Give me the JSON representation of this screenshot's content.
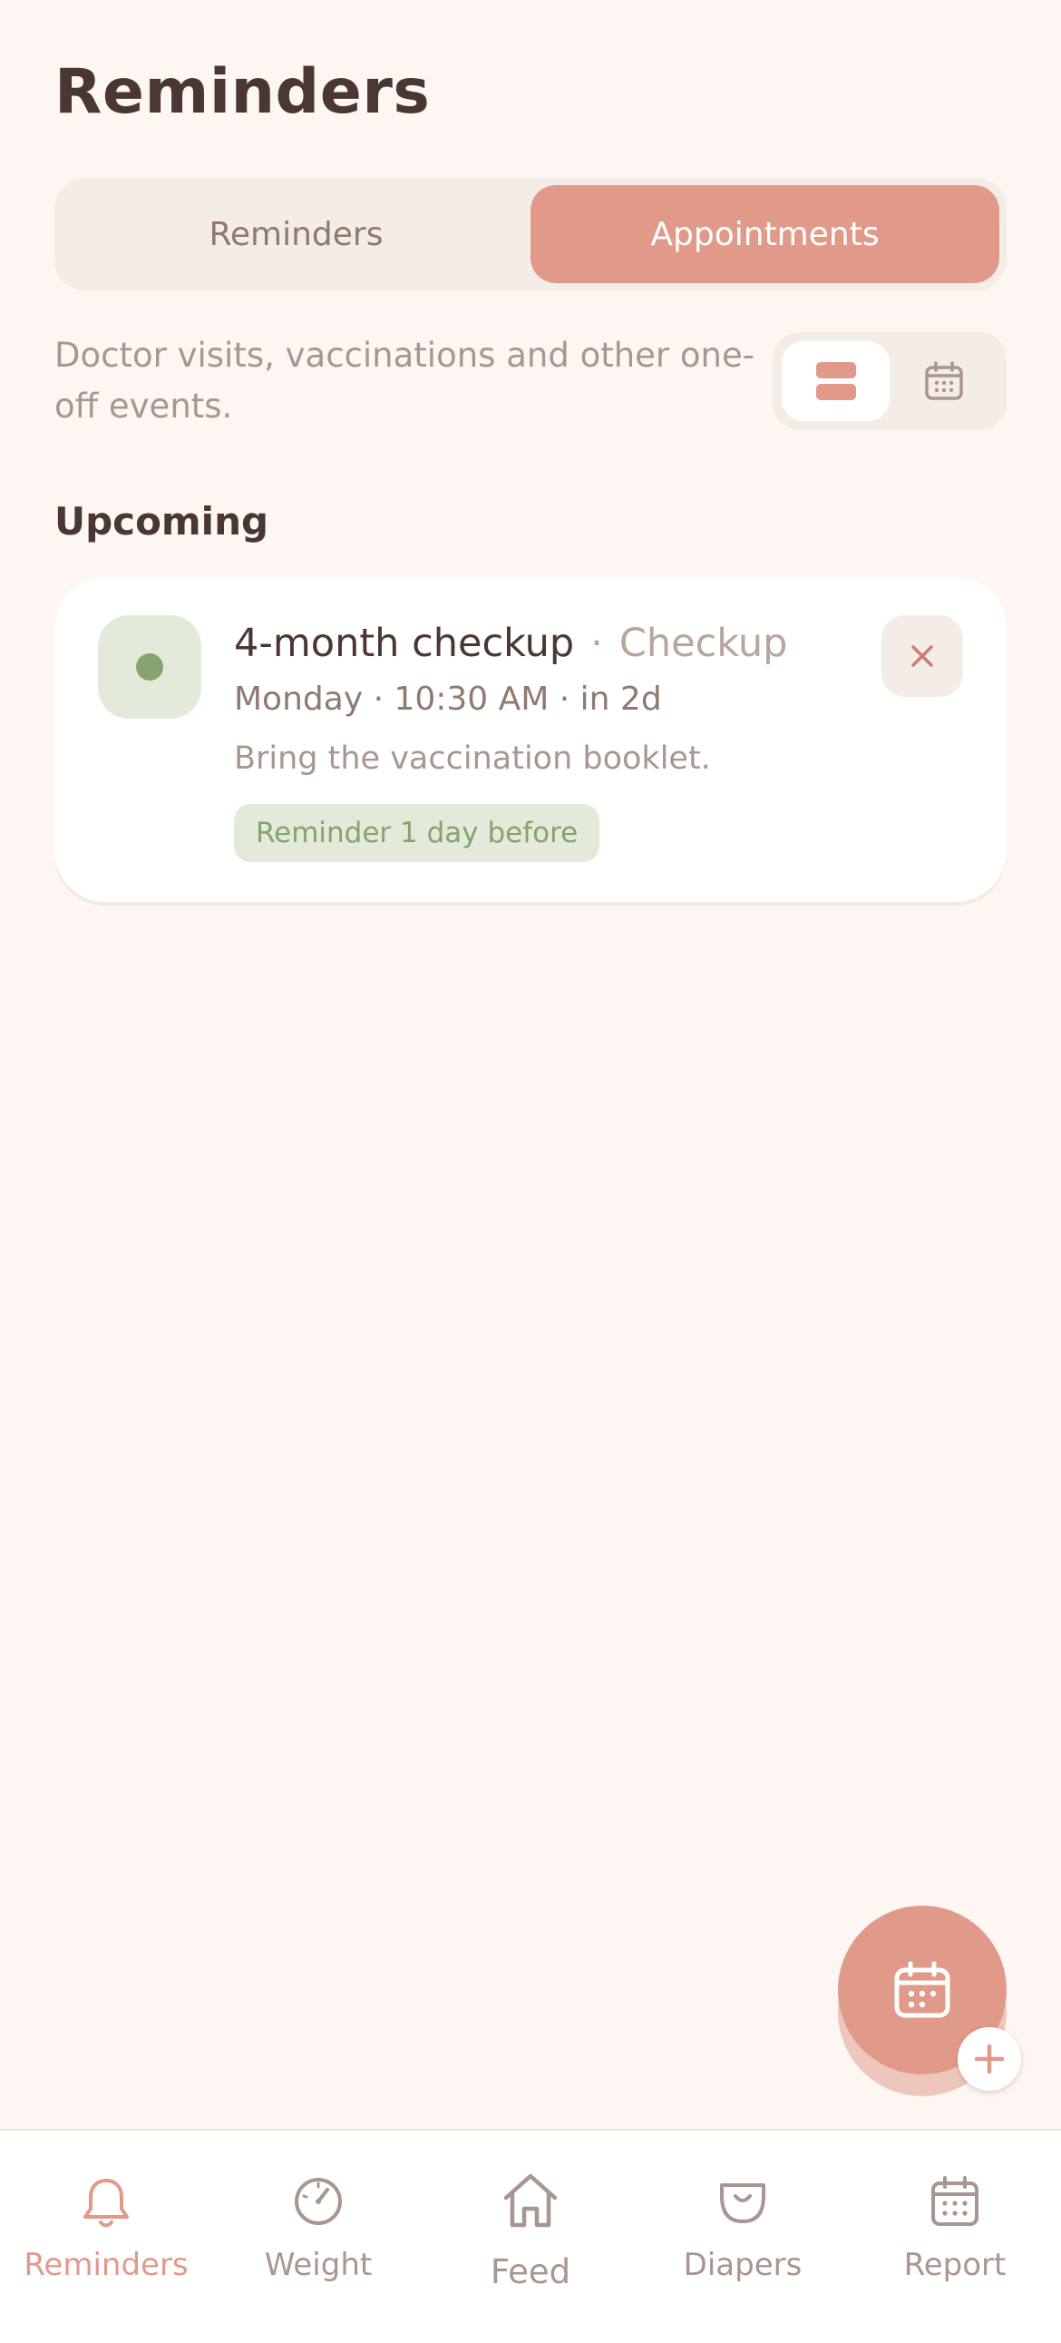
{
  "header": {
    "title": "Reminders"
  },
  "segmented": {
    "items": [
      "Reminders",
      "Appointments"
    ],
    "selected": "Appointments"
  },
  "description": "Doctor visits, vaccinations and other one-off events.",
  "view_toggle": {
    "list_icon": "list-view-icon",
    "calendar_icon": "calendar-icon",
    "selected": "list"
  },
  "section": {
    "title": "Upcoming"
  },
  "appointments": [
    {
      "title": "4-month checkup",
      "separator": "·",
      "kind": "Checkup",
      "time": "Monday · 10:30 AM · in 2d",
      "note": "Bring the vaccination booklet.",
      "badge": "Reminder 1 day before",
      "icon": "status-dot-icon",
      "close_icon": "close-icon"
    }
  ],
  "fab": {
    "icon": "calendar-add-icon"
  },
  "tabs": [
    {
      "label": "Reminders",
      "icon": "bell-icon",
      "active": true
    },
    {
      "label": "Weight",
      "icon": "scale-icon",
      "active": false
    },
    {
      "label": "Feed",
      "icon": "home-icon",
      "active": false
    },
    {
      "label": "Diapers",
      "icon": "diaper-icon",
      "active": false
    },
    {
      "label": "Report",
      "icon": "calendar-icon",
      "active": false
    }
  ],
  "colors": {
    "background": "#fdf6f2",
    "accent": "#e19a8a",
    "muted_surface": "#f4ece6",
    "success_bg": "#e3ead9",
    "success_fg": "#85a46e",
    "text": "#4a3732",
    "muted_text": "#a89690"
  }
}
